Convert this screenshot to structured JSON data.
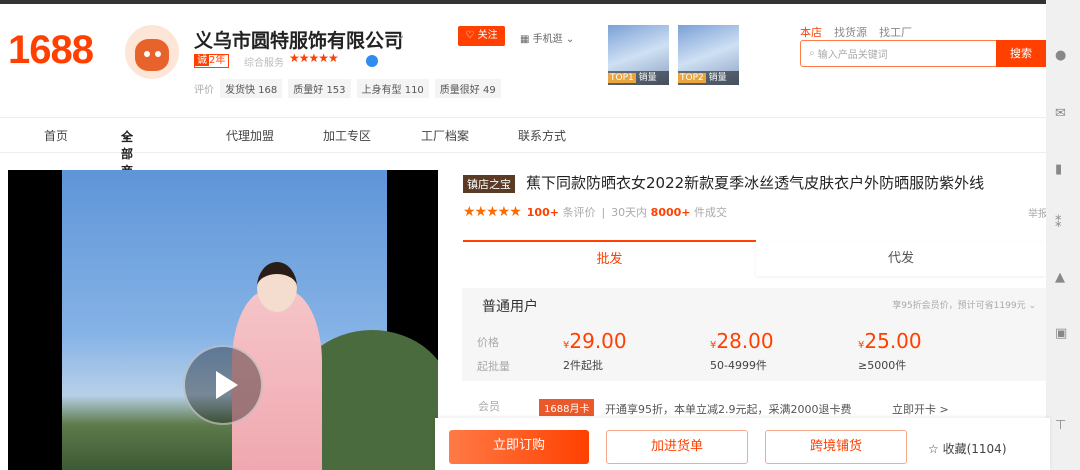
{
  "header": {
    "logo": "1688",
    "company": "义乌市圆特服饰有限公司",
    "years_badge_prefix": "诚",
    "years_badge": "2年",
    "service_label": "综合服务",
    "follow": "关注",
    "mobile": "手机逛",
    "eval_label": "评价",
    "eval_tags": [
      "发货快 168",
      "质量好 153",
      "上身有型 110",
      "质量很好 49"
    ],
    "top_items": [
      {
        "rank": "TOP1",
        "label": "销量"
      },
      {
        "rank": "TOP2",
        "label": "销量"
      }
    ],
    "search_tabs": [
      "本店",
      "找货源",
      "找工厂"
    ],
    "search_placeholder": "输入产品关键词",
    "search_button": "搜索"
  },
  "nav": [
    "首页",
    "全部商品",
    "代理加盟",
    "加工专区",
    "工厂档案",
    "联系方式"
  ],
  "product": {
    "badge": "镇店之宝",
    "title": "蕉下同款防晒衣女2022新款夏季冰丝透气皮肤衣户外防晒服防紫外线",
    "reviews": "100+",
    "reviews_label": "条评价",
    "period": "30天内",
    "sold": "8000+",
    "sold_label": "件成交",
    "report": "举报"
  },
  "tabs": [
    "批发",
    "代发"
  ],
  "pricing": {
    "user_type": "普通用户",
    "discount_note": "享95折会员价，预计可省1199元",
    "price_label": "价格",
    "moq_label": "起批量",
    "currency": "¥",
    "tiers": [
      {
        "price": "29.00",
        "qty": "2件起批"
      },
      {
        "price": "28.00",
        "qty": "50-4999件"
      },
      {
        "price": "25.00",
        "qty": "≥5000件"
      }
    ]
  },
  "member": {
    "label": "会员",
    "card": "1688月卡",
    "text": "开通享95折，本单立减2.9元起，采满2000退卡费",
    "open": "立即开卡 >"
  },
  "actions": {
    "buy": "立即订购",
    "cart": "加进货单",
    "cross": "跨境铺货",
    "favorite": "收藏(1104)"
  },
  "colors": {
    "accent": "#ff4000"
  }
}
